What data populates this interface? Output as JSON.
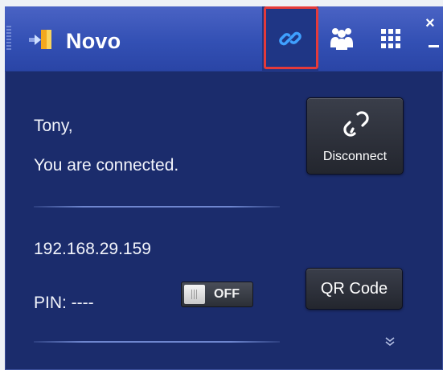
{
  "titlebar": {
    "app_title": "Novo",
    "logo_icon": "novo-logo-icon",
    "tabs": [
      {
        "icon": "link-icon",
        "selected": true
      },
      {
        "icon": "users-icon",
        "selected": false
      },
      {
        "icon": "grid-icon",
        "selected": false
      }
    ],
    "close_glyph": "×"
  },
  "main": {
    "greeting": "Tony,",
    "status": "You are connected.",
    "ip_address": "192.168.29.159",
    "pin": "PIN: ----",
    "pin_toggle": {
      "label": "OFF",
      "state": "off"
    },
    "disconnect_button": {
      "label": "Disconnect",
      "icon": "broken-link-icon"
    },
    "qr_button": {
      "label": "QR Code"
    },
    "expand_glyph": "»"
  },
  "colors": {
    "panel_background": "#1b2c6c",
    "titlebar": "#3350b4",
    "highlight_outline": "#e43a3a",
    "link_icon": "#3fa0ff"
  }
}
